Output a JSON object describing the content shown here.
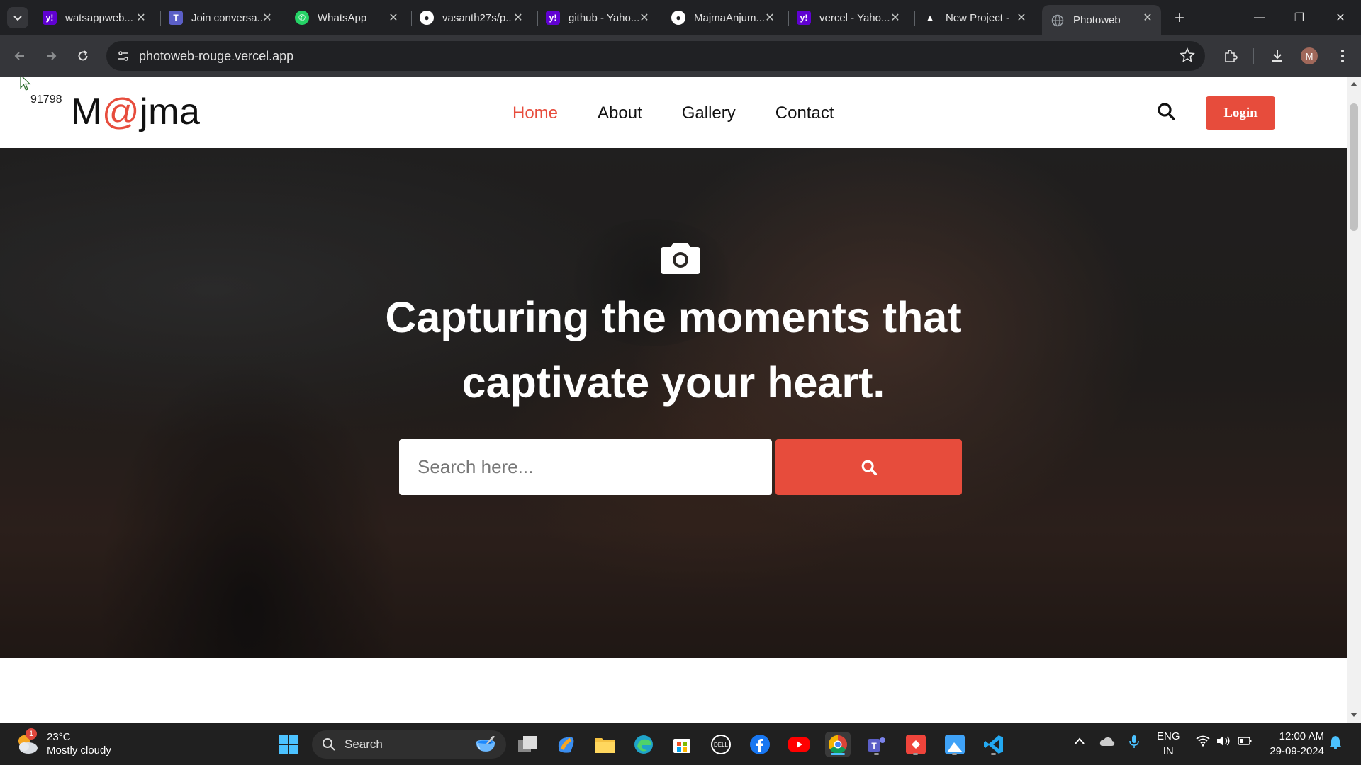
{
  "browser": {
    "tabs": [
      {
        "title": "watsappweb...",
        "favicon": "yahoo-icon",
        "color": "#6001d2"
      },
      {
        "title": "Join conversa...",
        "favicon": "teams-icon",
        "color": "#5b5fc7"
      },
      {
        "title": "WhatsApp",
        "favicon": "whatsapp-icon",
        "color": "#25d366"
      },
      {
        "title": "vasanth27s/p...",
        "favicon": "github-icon",
        "color": "#ffffff"
      },
      {
        "title": "github - Yaho...",
        "favicon": "yahoo-icon",
        "color": "#6001d2"
      },
      {
        "title": "MajmaAnjum...",
        "favicon": "github-icon",
        "color": "#ffffff"
      },
      {
        "title": "vercel - Yaho...",
        "favicon": "yahoo-icon",
        "color": "#6001d2"
      },
      {
        "title": "New Project -",
        "favicon": "vercel-icon",
        "color": "#ffffff"
      },
      {
        "title": "Photoweb",
        "favicon": "globe-icon",
        "color": "#9aa0a6",
        "active": true
      }
    ],
    "url": "photoweb-rouge.vercel.app",
    "profile_initial": "M"
  },
  "site": {
    "counter": "91798",
    "logo": {
      "prefix": "M",
      "at": "@",
      "suffix": "jma"
    },
    "nav": [
      {
        "label": "Home",
        "active": true
      },
      {
        "label": "About"
      },
      {
        "label": "Gallery"
      },
      {
        "label": "Contact"
      }
    ],
    "login_label": "Login",
    "accent_color": "#e74c3c",
    "hero": {
      "title_line1": "Capturing the moments that",
      "title_line2": "captivate your heart.",
      "search_placeholder": "Search here...",
      "icon": "camera-icon"
    }
  },
  "taskbar": {
    "weather": {
      "temp": "23°C",
      "condition": "Mostly cloudy",
      "badge": "1"
    },
    "search_label": "Search",
    "lang_line1": "ENG",
    "lang_line2": "IN",
    "time": "12:00 AM",
    "date": "29-09-2024"
  }
}
